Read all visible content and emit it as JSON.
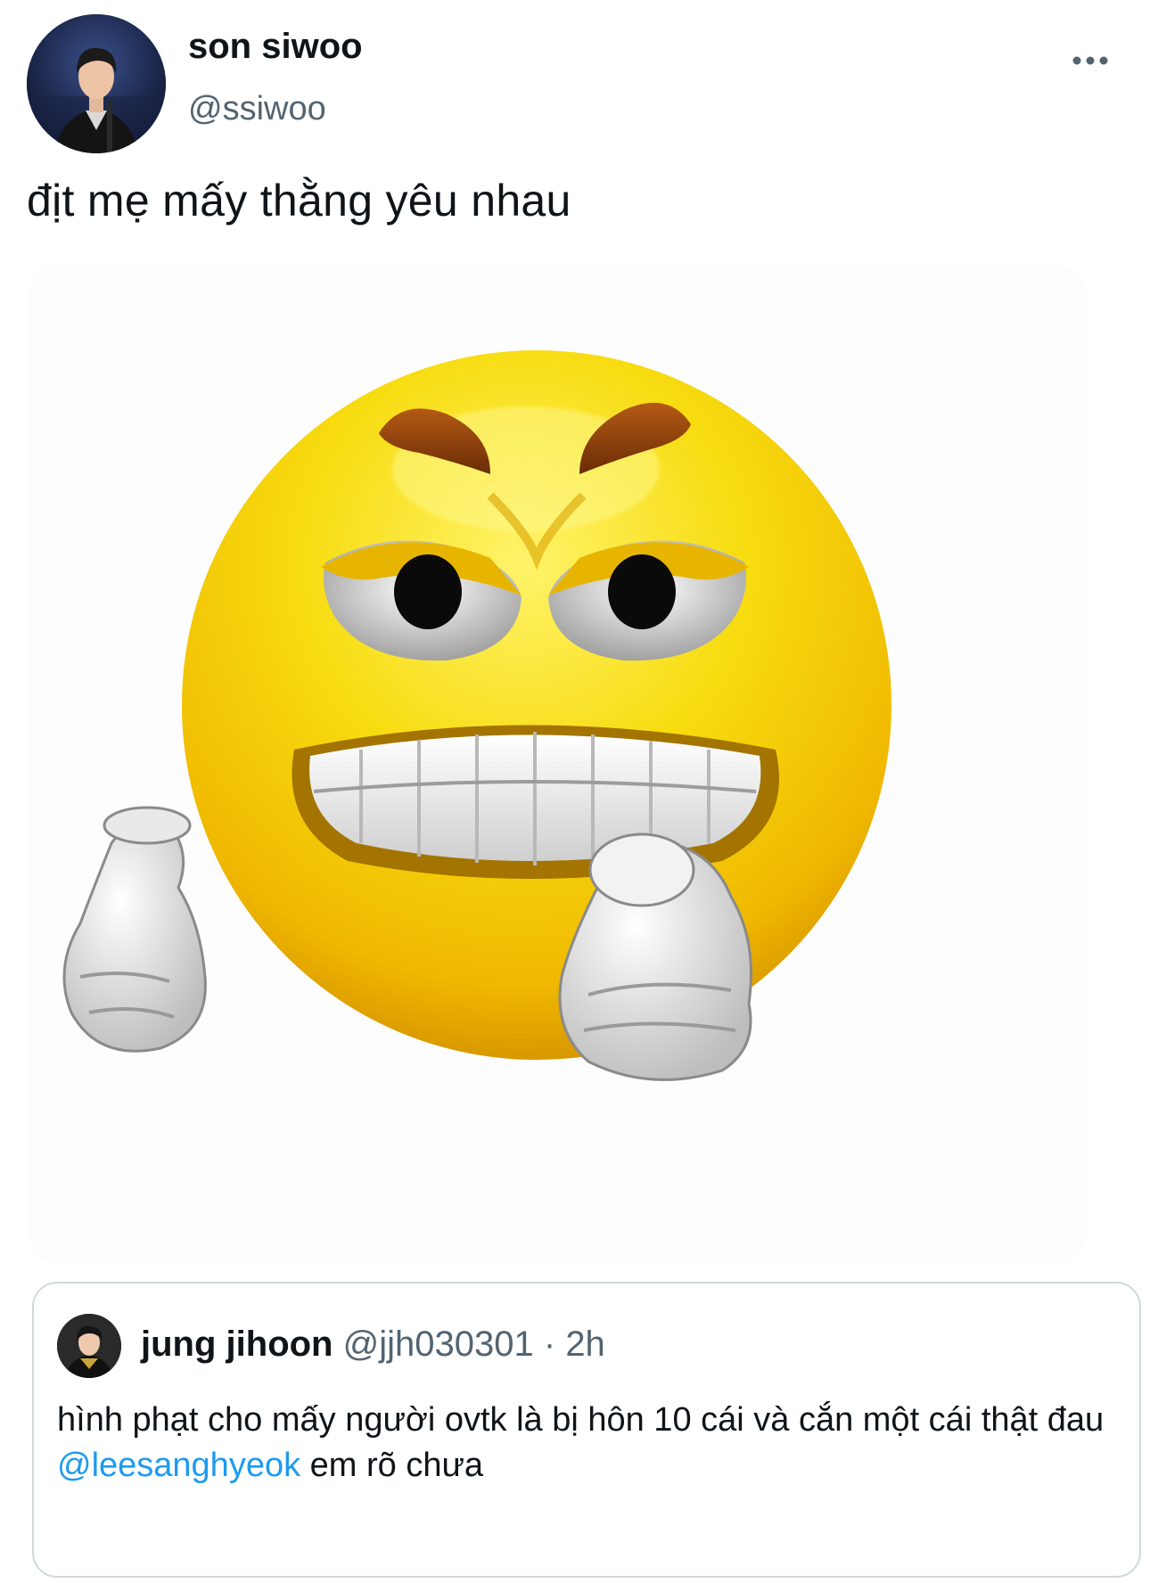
{
  "tweet": {
    "author": {
      "display_name": "son siwoo",
      "handle": "@ssiwoo",
      "avatar_icon": "user-avatar-photo"
    },
    "more_icon": "more-horizontal-icon",
    "text": "địt mẹ mấy thằng yêu nhau",
    "media": {
      "icon": "angry-emoji-image",
      "face_color": "#f5d20a",
      "eyebrow_color": "#8a3d0c"
    }
  },
  "quote": {
    "author": {
      "display_name": "jung jihoon",
      "handle": "@jjh030301",
      "separator": "·",
      "time": "2h",
      "avatar_icon": "user-avatar-photo"
    },
    "text": "hình phạt cho mấy người ovtk là bị hôn 10 cái và cắn một cái thật đau",
    "mention": "@leesanghyeok",
    "suffix": " em rõ chưa"
  },
  "colors": {
    "text_primary": "#0f1419",
    "text_secondary": "#536471",
    "link": "#1d9bf0",
    "border": "#cfd9de"
  }
}
